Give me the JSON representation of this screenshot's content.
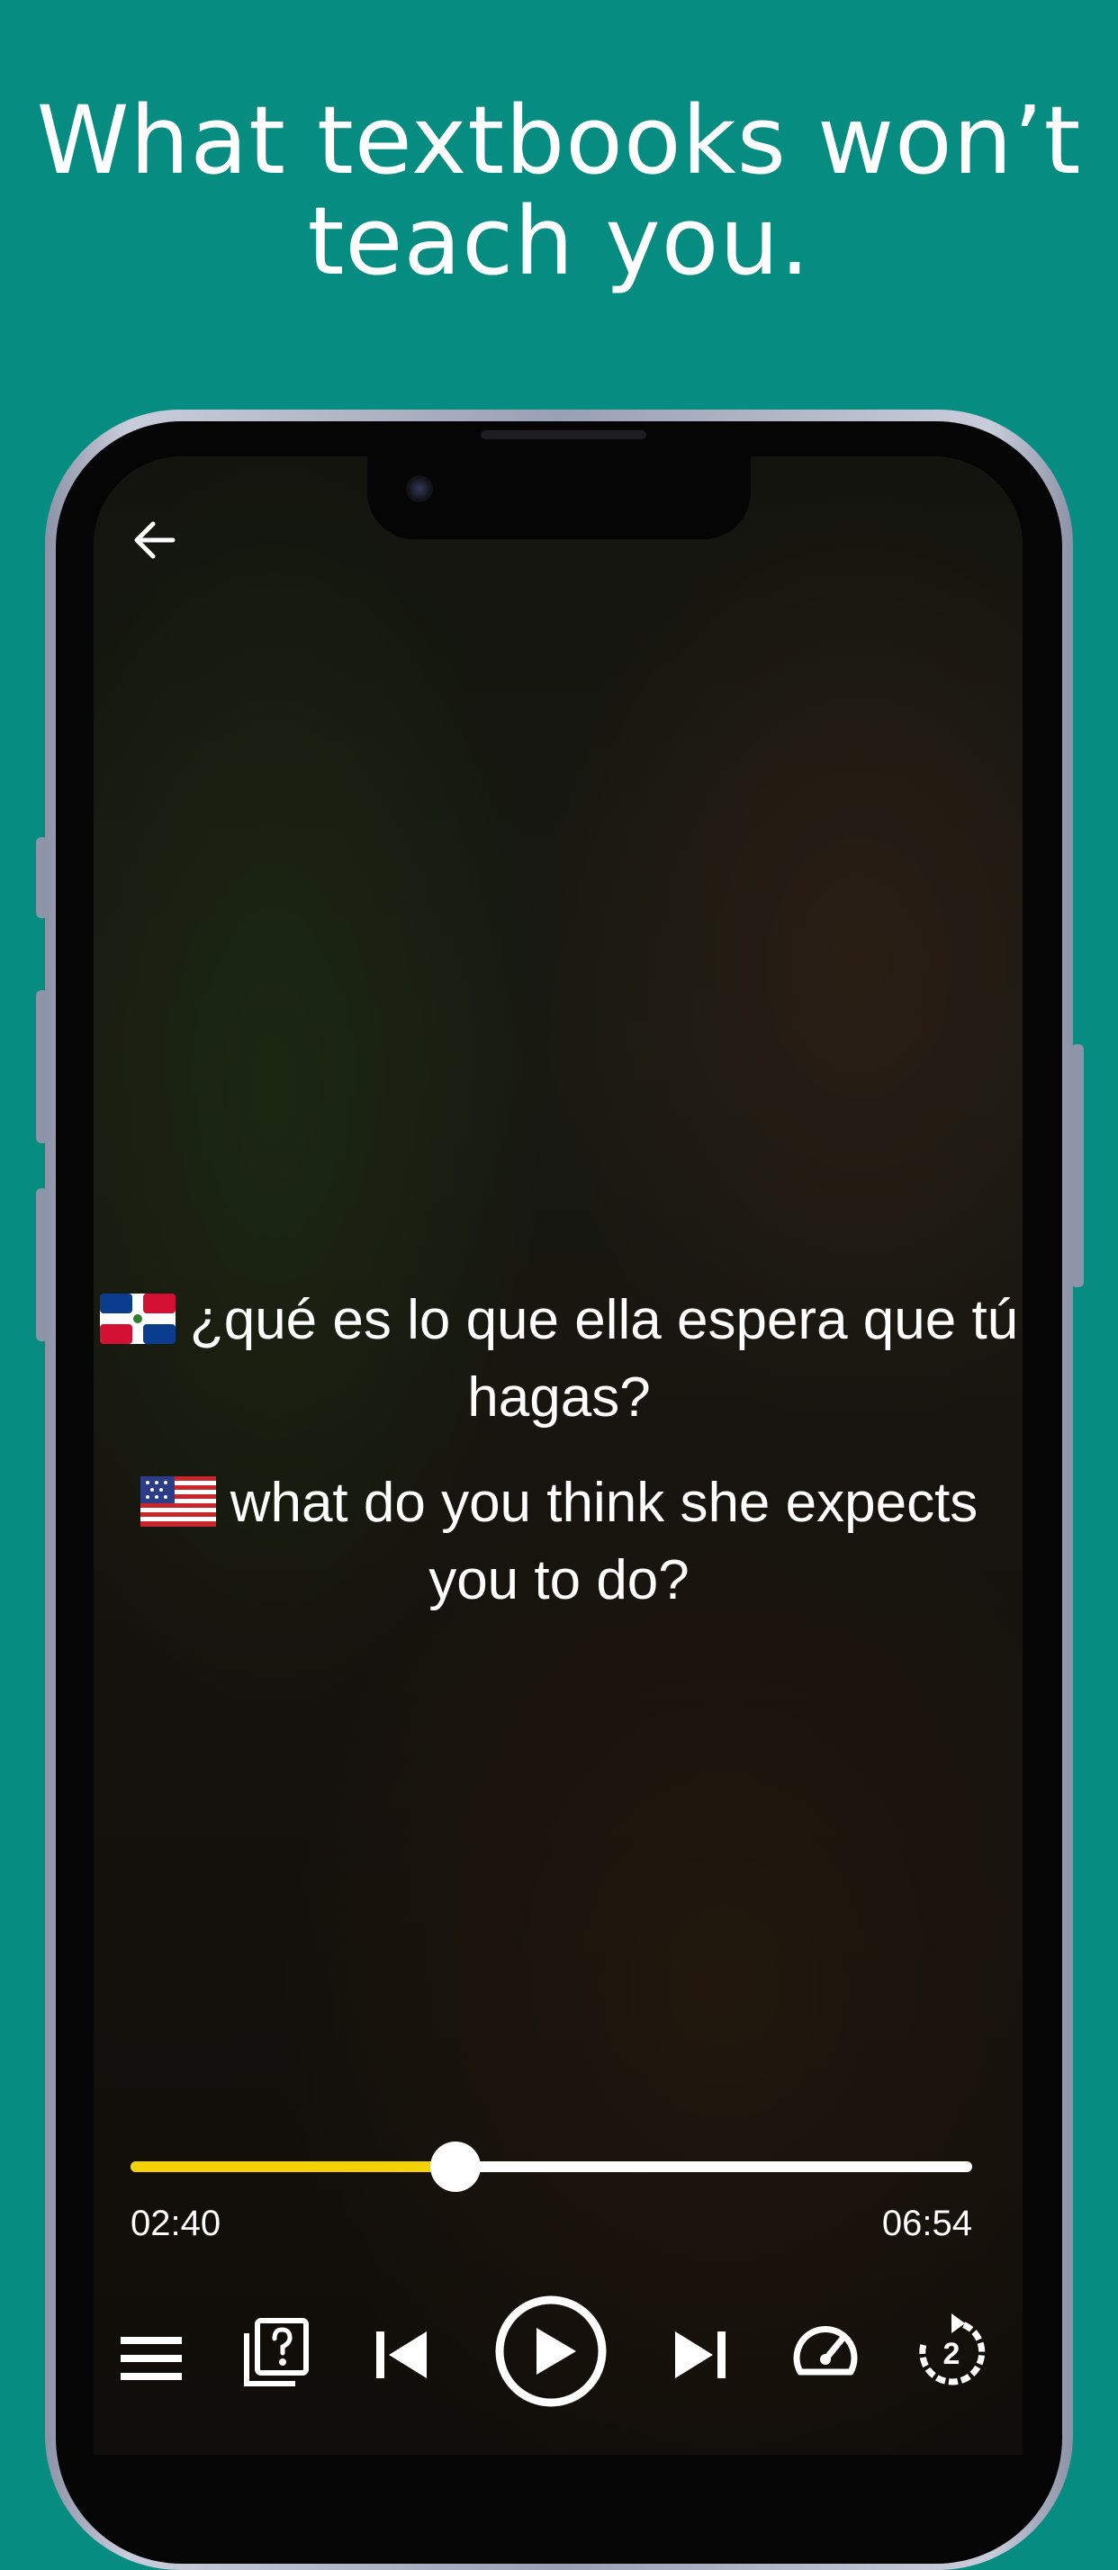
{
  "headline": {
    "line1": "What textbooks won’t",
    "line2": "teach you."
  },
  "player": {
    "subtitle_original": {
      "flag": "dominican-republic-flag",
      "text": "¿qué es lo que ella espera que tú hagas?"
    },
    "subtitle_translation": {
      "flag": "us-flag",
      "text": "what do you think she expects you to do?"
    },
    "current_time": "02:40",
    "duration": "06:54",
    "progress_fraction": 0.386,
    "replay_seconds": "2",
    "controls": [
      "menu-icon",
      "quiz-icon",
      "previous-icon",
      "play-icon",
      "next-icon",
      "speed-icon",
      "replay-icon"
    ]
  },
  "colors": {
    "background": "#078c82",
    "progress": "#f4d100"
  }
}
